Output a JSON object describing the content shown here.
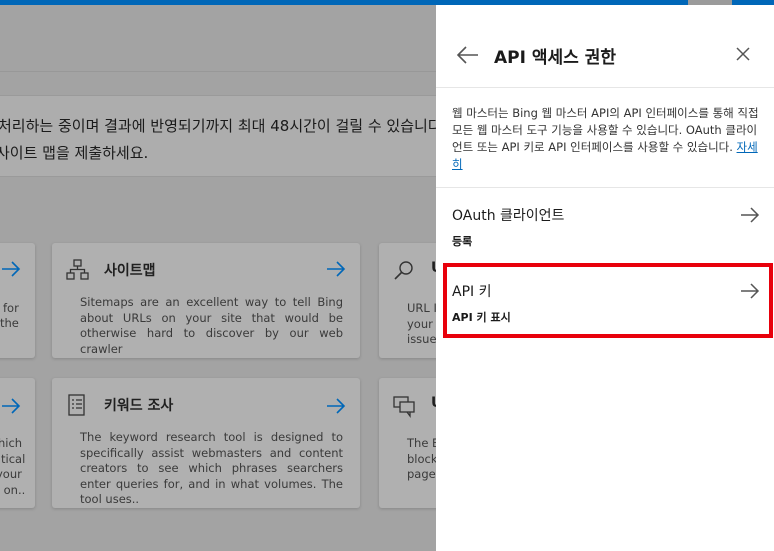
{
  "background": {
    "notice_line1": "처리하는 중이며 결과에 반영되기까지 최대 48시간이 걸릴 수 있습니다",
    "notice_line2": "사이트 맵을 제출하세요.",
    "cards": [
      {
        "title": "사이트맵",
        "description": "Sitemaps are an excellent way to tell Bing about URLs on your site that would be otherwise hard to discover by our web crawler"
      },
      {
        "title": "키워드 조사",
        "description": "The keyword research tool is designed to specifically assist webmasters and content creators to see which phrases searchers enter queries for, and in what volumes. The tool uses.."
      }
    ],
    "left_fragments_row1": [
      "for",
      "the"
    ],
    "left_fragments_row2": [
      "hich",
      "tical",
      "your",
      "s on.."
    ],
    "right_card_row1": {
      "title": "U",
      "lines": [
        "URL I",
        "your",
        "issue"
      ]
    },
    "right_card_row2": {
      "title": "U",
      "lines": [
        "The B",
        "block",
        "pages"
      ]
    }
  },
  "panel": {
    "title": "API 액세스 권한",
    "description": "웹 마스터는 Bing 웹 마스터 API의 API 인터페이스를 통해 직접 모든 웹 마스터 도구 기능을 사용할 수 있습니다. OAuth 클라이언트 또는 API 키로 API 인터페이스를 사용할 수 있습니다.",
    "learn_more": "자세히",
    "options": [
      {
        "title": "OAuth 클라이언트",
        "subtitle": "등록"
      },
      {
        "title": "API 키",
        "subtitle": "API 키 표시"
      }
    ]
  },
  "colors": {
    "accent": "#0067b8",
    "highlight": "#e8000b"
  }
}
